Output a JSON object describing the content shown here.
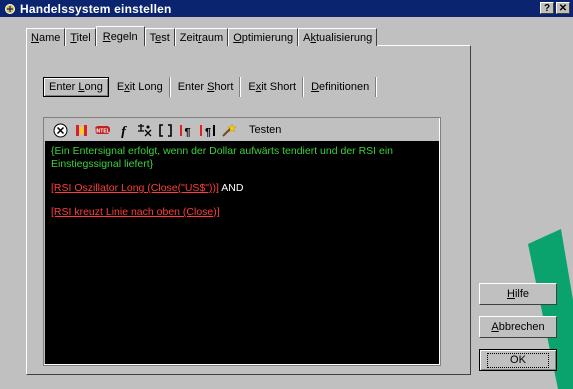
{
  "window": {
    "title": "Handelssystem einstellen",
    "help_btn": "?",
    "close_btn": "✕"
  },
  "tabs": [
    {
      "pre": "",
      "u": "N",
      "post": "ame"
    },
    {
      "pre": "",
      "u": "T",
      "post": "itel"
    },
    {
      "pre": "",
      "u": "R",
      "post": "egeln"
    },
    {
      "pre": "T",
      "u": "e",
      "post": "st"
    },
    {
      "pre": "Zeit",
      "u": "r",
      "post": "aum"
    },
    {
      "pre": "",
      "u": "O",
      "post": "ptimierung"
    },
    {
      "pre": "A",
      "u": "k",
      "post": "tualisierung"
    }
  ],
  "subtabs": [
    {
      "pre": "Enter ",
      "u": "L",
      "post": "ong"
    },
    {
      "pre": "E",
      "u": "x",
      "post": "it Long"
    },
    {
      "pre": "Enter ",
      "u": "S",
      "post": "hort"
    },
    {
      "pre": "E",
      "u": "x",
      "post": "it Short"
    },
    {
      "pre": "",
      "u": "D",
      "post": "efinitionen"
    }
  ],
  "toolbar": {
    "testen": "Testen",
    "icons": [
      "operator-icon",
      "bracket-icon",
      "data-icon",
      "function-icon",
      "indicator-icon",
      "brackets-icon",
      "paragraph-icon",
      "paragraph-bracket-icon",
      "wand-icon"
    ]
  },
  "code": {
    "comment": "{Ein Entersignal erfolgt, wenn der Dollar aufwärts tendiert und der RSI ein Einstiegssignal liefert}",
    "rule1": "[RSI Oszillator Long (Close(\"US$\"))]",
    "and": "AND",
    "rule2": "[RSI kreuzt Linie nach oben (Close)]"
  },
  "buttons": {
    "hilfe_u": "H",
    "hilfe_post": "ilfe",
    "abbrechen_u": "A",
    "abbrechen_post": "bbrechen",
    "ok": "OK"
  },
  "colors": {
    "titlebar": "#0a2470",
    "comment": "#3bd13b",
    "keyword": "#ff3b3b",
    "stroke": "#0aa36e"
  }
}
